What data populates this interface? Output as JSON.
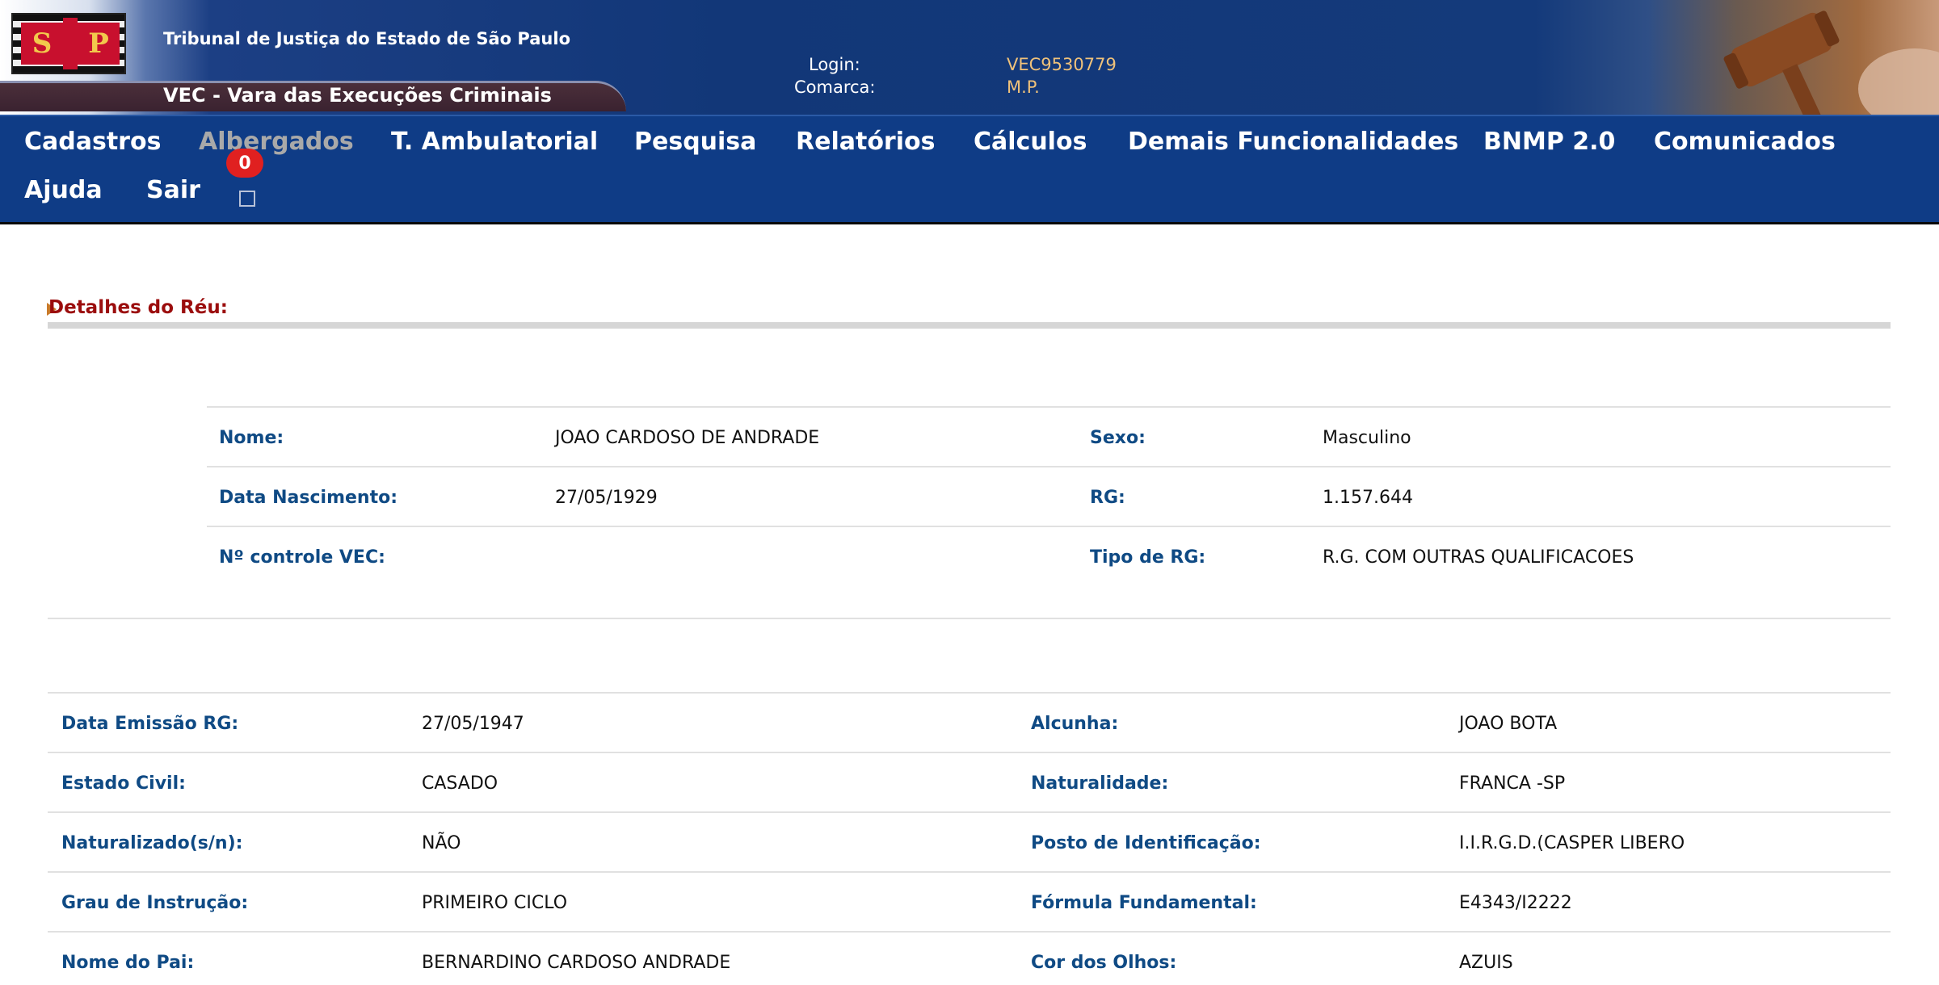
{
  "header": {
    "court_title": "Tribunal de Justiça do Estado de São Paulo",
    "vec_title": "VEC - Vara das Execuções Criminais",
    "login_label": "Login:",
    "login_value": "VEC9530779",
    "comarca_label": "Comarca:",
    "comarca_value": "M.P.",
    "logo_letters": [
      "S",
      "P"
    ]
  },
  "nav": {
    "items": [
      "Cadastros",
      "Albergados",
      "T. Ambulatorial",
      "Pesquisa",
      "Relatórios",
      "Cálculos",
      "Demais Funcionalidades",
      "BNMP 2.0",
      "Comunicados",
      "Ajuda",
      "Sair"
    ],
    "disabled_item": "Albergados",
    "badge_count": "0"
  },
  "section": {
    "title": "Detalhes do Réu:"
  },
  "main_info": {
    "rows": [
      {
        "label1": "Nome:",
        "value1": "JOAO CARDOSO DE ANDRADE",
        "label2": "Sexo:",
        "value2": "Masculino"
      },
      {
        "label1": "Data Nascimento:",
        "value1": "27/05/1929",
        "label2": "RG:",
        "value2": "1.157.644"
      },
      {
        "label1": "Nº controle VEC:",
        "value1": "",
        "label2": "Tipo de RG:",
        "value2": "R.G. COM OUTRAS QUALIFICACOES"
      }
    ]
  },
  "extra_info": {
    "rows": [
      {
        "label1": "Data Emissão RG:",
        "value1": "27/05/1947",
        "label2": "Alcunha:",
        "value2": "JOAO BOTA"
      },
      {
        "label1": "Estado Civil:",
        "value1": "CASADO",
        "label2": "Naturalidade:",
        "value2": "FRANCA -SP"
      },
      {
        "label1": "Naturalizado(s/n):",
        "value1": "NÃO",
        "label2": "Posto de Identificação:",
        "value2": "I.I.R.G.D.(CASPER LIBERO"
      },
      {
        "label1": "Grau de Instrução:",
        "value1": "PRIMEIRO CICLO",
        "label2": "Fórmula Fundamental:",
        "value2": "E4343/I2222"
      },
      {
        "label1": "Nome do Pai:",
        "value1": "BERNARDINO CARDOSO ANDRADE",
        "label2": "Cor dos Olhos:",
        "value2": "AZUIS"
      }
    ]
  },
  "colors": {
    "nav_bg": "#0f3c86",
    "label": "#0f4a84",
    "section_title": "#9b0d0d",
    "badge": "#e02020",
    "login_value": "#f0c27a"
  },
  "icons": {
    "logo": "sao-paulo-coat-of-arms",
    "gavel": "gavel-icon",
    "section_arrow": "arrow-right-icon",
    "nav_checkbox": "checkbox-icon"
  }
}
